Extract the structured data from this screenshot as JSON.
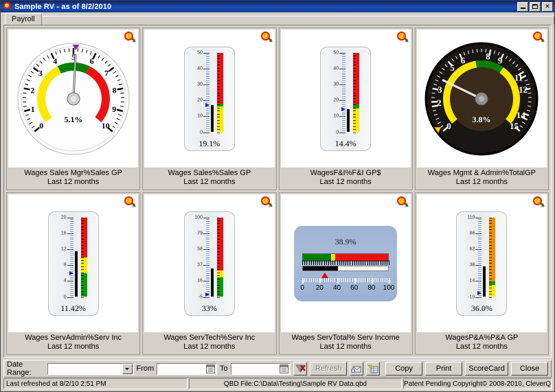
{
  "window": {
    "title": "Sample RV - as of 8/2/2010",
    "icon": "magnifier-q-icon",
    "minimize": "minimize-icon",
    "maximize": "maximize-icon",
    "close": "close-icon"
  },
  "tabs": [
    {
      "label": "Payroll",
      "active": true
    }
  ],
  "cards": [
    {
      "type": "dial",
      "title": "Wages Sales Mgr%Sales GP",
      "subtitle": "Last 12 months",
      "value_label": "5.1%",
      "value": 5.1,
      "min": 0,
      "max": 10,
      "ticks": [
        0,
        1,
        2,
        3,
        4,
        5,
        6,
        7,
        8,
        9,
        10
      ],
      "bands": [
        {
          "from": 0,
          "to": 4,
          "color": "#ffe800"
        },
        {
          "from": 4,
          "to": 6,
          "color": "#008000"
        },
        {
          "from": 6,
          "to": 10,
          "color": "#ee1111"
        }
      ],
      "marker": 5.1,
      "marker_color": "#7a2ab0",
      "face": "light",
      "zoom_icon": "drill-down-icon"
    },
    {
      "type": "thermo",
      "title": "Wages Sales%Sales GP",
      "subtitle": "Last 12 months",
      "value_label": "19.1%",
      "value": 17.0,
      "min": 0,
      "max": 50,
      "ticks": [
        0,
        10,
        20,
        30,
        40,
        50
      ],
      "bands": [
        {
          "from": 0,
          "to": 16,
          "color": "#ffe800"
        },
        {
          "from": 16,
          "to": 18,
          "color": "#089a08"
        },
        {
          "from": 18,
          "to": 50,
          "color": "#ee1111"
        }
      ],
      "marker": 17.0,
      "marker_color": "#1a1ad0",
      "zoom_icon": "drill-down-icon"
    },
    {
      "type": "thermo",
      "title": "WagesF&I%F&I GP$",
      "subtitle": "Last 12 months",
      "value_label": "14.4%",
      "value": 14.4,
      "min": 0,
      "max": 50,
      "ticks": [
        0,
        10,
        20,
        30,
        40,
        50
      ],
      "bands": [
        {
          "from": 0,
          "to": 15,
          "color": "#ffe800"
        },
        {
          "from": 15,
          "to": 17.5,
          "color": "#089a08"
        },
        {
          "from": 17.5,
          "to": 50,
          "color": "#ee1111"
        }
      ],
      "marker": 14.4,
      "marker_color": "#1a1ad0",
      "zoom_icon": "drill-down-icon"
    },
    {
      "type": "dial",
      "title": "Wages Mgmt & Admin%TotalGP",
      "subtitle": "Last 12 months",
      "value_label": "3.8%",
      "value": 3.8,
      "min": 0,
      "max": 15,
      "ticks": [
        0,
        2,
        3,
        5,
        6,
        8,
        9,
        11,
        12,
        14,
        15
      ],
      "bands": [
        {
          "from": 0,
          "to": 7,
          "color": "#ffe800"
        },
        {
          "from": 7,
          "to": 9.5,
          "color": "#008000"
        },
        {
          "from": 9.5,
          "to": 15,
          "color": "#ffe800"
        }
      ],
      "marker": 0.3,
      "marker_color": "#ffd000",
      "face": "dark",
      "zoom_icon": "drill-down-icon"
    },
    {
      "type": "thermo",
      "title": "Wages ServAdmin%Serv Inc",
      "subtitle": "Last 12 months",
      "value_label": "11.42%",
      "value": 11.42,
      "min": 0,
      "max": 20,
      "ticks": [
        0,
        4,
        8,
        12,
        16,
        20
      ],
      "bands": [
        {
          "from": 0,
          "to": 6,
          "color": "#089a08"
        },
        {
          "from": 6,
          "to": 10,
          "color": "#ffe800"
        },
        {
          "from": 10,
          "to": 20,
          "color": "#ee1111"
        }
      ],
      "marker": 6.0,
      "marker_color": "#1a1ad0",
      "zoom_icon": "drill-down-icon"
    },
    {
      "type": "thermo",
      "title": "Wages ServTech%Serv Inc",
      "subtitle": "Last 12 months",
      "value_label": "33%",
      "value": 33,
      "min": -5,
      "max": 100,
      "ticks": [
        -5,
        16,
        37,
        58,
        79,
        100
      ],
      "bands": [
        {
          "from": -5,
          "to": 21,
          "color": "#089a08"
        },
        {
          "from": 21,
          "to": 30,
          "color": "#ffe800"
        },
        {
          "from": 30,
          "to": 100,
          "color": "#ee1111"
        }
      ],
      "marker": -2,
      "marker_color": "#1a1ad0",
      "zoom_icon": "drill-down-icon"
    },
    {
      "type": "hbullet",
      "title": "Wages ServTotal% Serv Income",
      "subtitle": "Last 12 months",
      "value_label": "38.9%",
      "value": 41,
      "min": 0,
      "max": 100,
      "ticks": [
        0,
        20,
        40,
        60,
        80,
        100
      ],
      "bands": [
        {
          "from": 0,
          "to": 33,
          "color": "#008000"
        },
        {
          "from": 33,
          "to": 38,
          "color": "#ffe800"
        },
        {
          "from": 38,
          "to": 100,
          "color": "#ee1111"
        }
      ],
      "marker": 26,
      "marker_color": "#e00000",
      "zoom_icon": "drill-down-icon"
    },
    {
      "type": "thermo",
      "title": "WagesP&A%P&A GP",
      "subtitle": "Last 12 months",
      "value_label": "36.0%",
      "value": 36,
      "min": -10,
      "max": 110,
      "ticks": [
        -10,
        14,
        38,
        62,
        86,
        110
      ],
      "bands": [
        {
          "from": -10,
          "to": 8,
          "color": "#ffe800"
        },
        {
          "from": 8,
          "to": 13,
          "color": "#089a08"
        },
        {
          "from": 13,
          "to": 110,
          "color": "#f28c00"
        }
      ],
      "marker": -4,
      "marker_color": "#1a1ad0",
      "zoom_icon": "drill-down-icon"
    }
  ],
  "toolbar": {
    "date_range_label": "Date Range:",
    "date_range_value": "",
    "date_range_placeholder": "",
    "from_label": "From",
    "from_value": "",
    "to_label": "To",
    "to_value": "",
    "clear_filter_icon": "clear-filter-icon",
    "refresh_label": "Refresh",
    "refresh_disabled": true,
    "email_icon": "send-email-icon",
    "export_icon": "export-excel-icon",
    "copy_label": "Copy",
    "print_label": "Print",
    "scorecard_label": "ScoreCard",
    "close_label": "Close"
  },
  "statusbar": {
    "refreshed": "Last refreshed at 8/2/10 2:51 PM",
    "file": "QBD File:C:\\Data\\Testing\\Sample RV Data.qbd",
    "copyright": "Patent Pending Copyright© 2008-2010, CleverQ"
  }
}
